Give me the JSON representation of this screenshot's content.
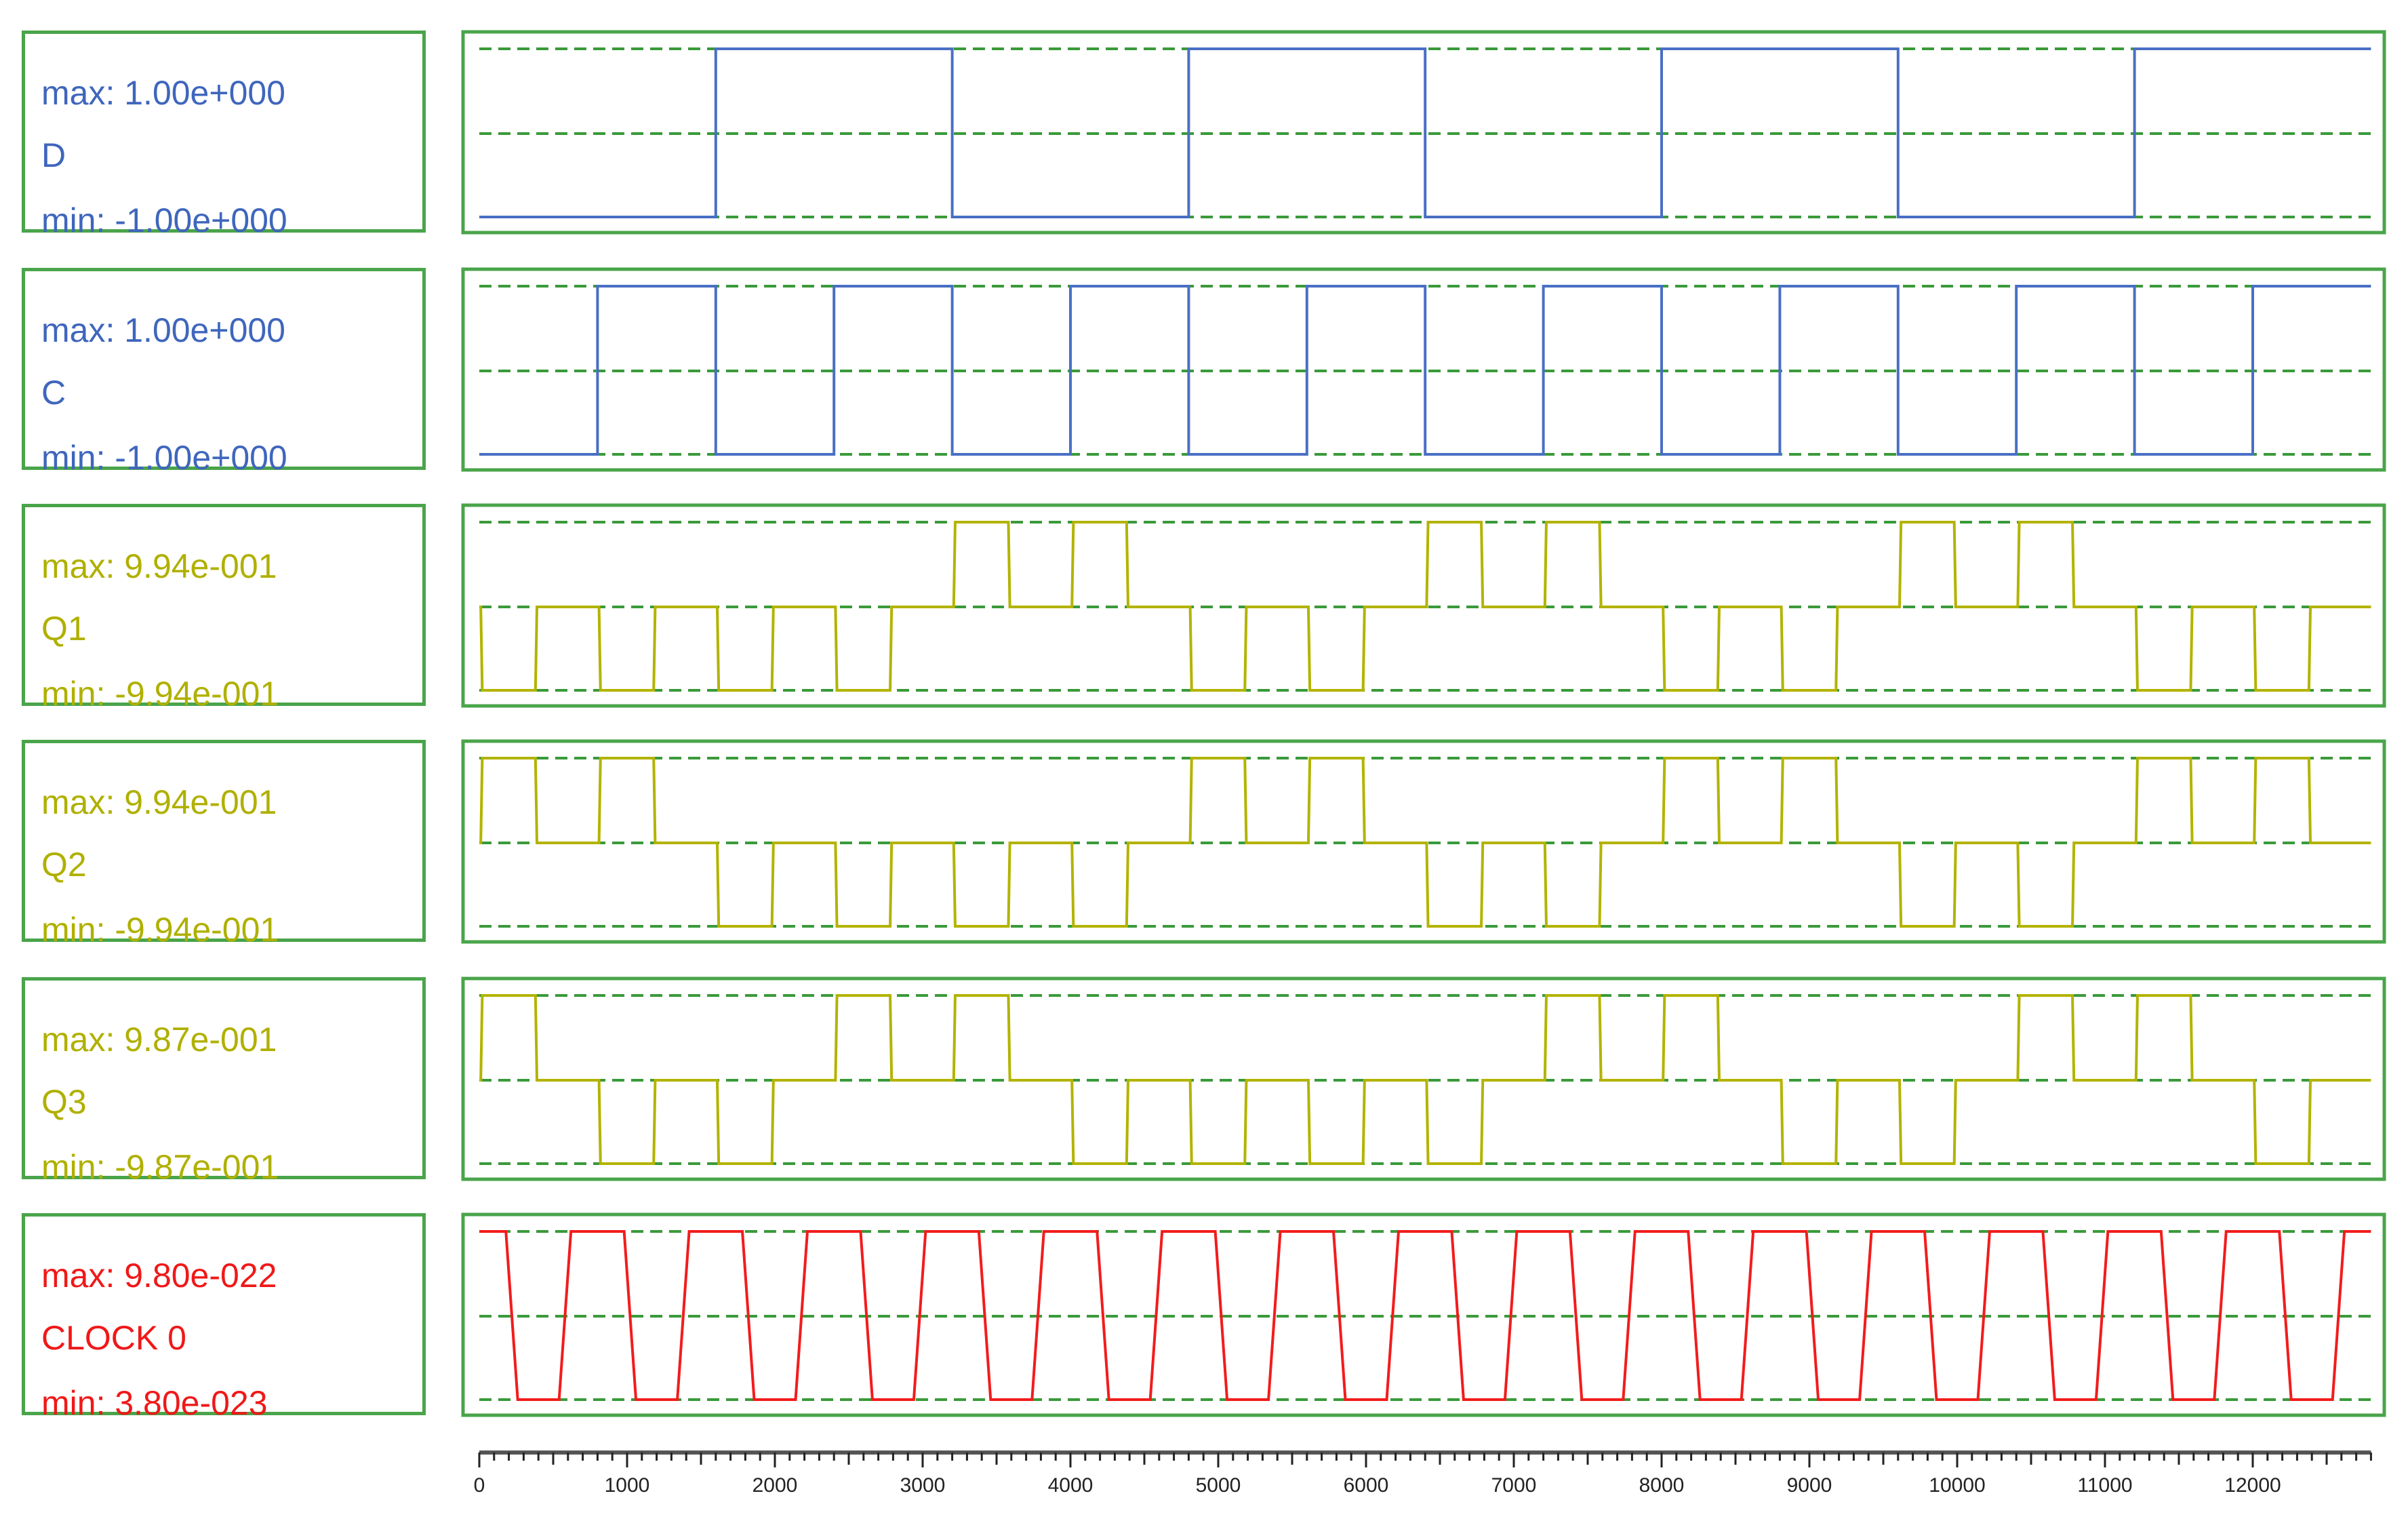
{
  "colors": {
    "frame": "#4aa44a",
    "grid": "#3a9a3a",
    "blue": "#4a6fc4",
    "olive": "#b3b300",
    "red": "#f21c1c",
    "axis": "#222222"
  },
  "rows": [
    {
      "name": "D",
      "max": "max: 1.00e+000",
      "min": "min: -1.00e+000",
      "color": "#3f66bd"
    },
    {
      "name": "C",
      "max": "max: 1.00e+000",
      "min": "min: -1.00e+000",
      "color": "#3f66bd"
    },
    {
      "name": "Q1",
      "max": "max: 9.94e-001",
      "min": "min: -9.94e-001",
      "color": "#b0b000"
    },
    {
      "name": "Q2",
      "max": "max: 9.94e-001",
      "min": "min: -9.94e-001",
      "color": "#b0b000"
    },
    {
      "name": "Q3",
      "max": "max: 9.87e-001",
      "min": "min: -9.87e-001",
      "color": "#b0b000"
    },
    {
      "name": "CLOCK 0",
      "max": "max: 9.80e-022",
      "min": "min: 3.80e-023",
      "color": "#f01818"
    }
  ],
  "chart_data": {
    "type": "line",
    "xlim": [
      0,
      12800
    ],
    "ylim": [
      -1,
      1
    ],
    "grid": true,
    "x_ticks": [
      "0",
      "1000",
      "2000",
      "3000",
      "4000",
      "5000",
      "6000",
      "7000",
      "8000",
      "9000",
      "10000",
      "11000",
      "12000"
    ],
    "minor_tick_step": 100,
    "series": [
      {
        "name": "D",
        "kind": "square",
        "period_segment": 1600,
        "levels": [
          -1,
          1,
          -1,
          1,
          -1,
          1,
          -1,
          1
        ]
      },
      {
        "name": "C",
        "kind": "square",
        "period_segment": 800,
        "levels": [
          -1,
          1,
          -1,
          1,
          -1,
          1,
          -1,
          1,
          -1,
          1,
          -1,
          1,
          -1,
          1,
          -1,
          1
        ]
      },
      {
        "name": "Q1",
        "kind": "pulses",
        "pulse_period": 800,
        "pulse_width": 370,
        "baseline": 0,
        "signs": [
          -1,
          -1,
          -1,
          -1,
          1,
          1,
          -1,
          -1,
          1,
          1,
          -1,
          -1,
          1,
          1,
          -1,
          -1
        ]
      },
      {
        "name": "Q2",
        "kind": "pulses",
        "pulse_period": 800,
        "pulse_width": 370,
        "baseline": 0,
        "signs": [
          1,
          1,
          -1,
          -1,
          -1,
          -1,
          1,
          1,
          -1,
          -1,
          1,
          1,
          -1,
          -1,
          1,
          1
        ]
      },
      {
        "name": "Q3",
        "kind": "pulses",
        "pulse_period": 800,
        "pulse_width": 370,
        "baseline": 0,
        "signs": [
          1,
          -1,
          -1,
          1,
          1,
          -1,
          -1,
          -1,
          -1,
          1,
          1,
          -1,
          -1,
          1,
          1,
          -1
        ]
      },
      {
        "name": "CLOCK 0",
        "kind": "clock",
        "period": 800,
        "fall_start": 180,
        "fall_end": 260,
        "rise_start": 540,
        "rise_end": 620
      }
    ]
  }
}
